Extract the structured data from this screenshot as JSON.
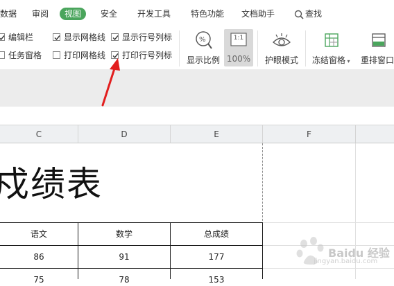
{
  "menu": {
    "tabs": [
      "数据",
      "审阅",
      "视图",
      "安全",
      "开发工具",
      "特色功能",
      "文档助手"
    ],
    "active": "视图",
    "search_label": "查找"
  },
  "ribbon": {
    "checkboxes": [
      {
        "label": "编辑栏",
        "checked": true
      },
      {
        "label": "任务窗格",
        "checked": false
      },
      {
        "label": "显示网格线",
        "checked": true
      },
      {
        "label": "打印网格线",
        "checked": false
      },
      {
        "label": "显示行号列标",
        "checked": true
      },
      {
        "label": "打印行号列标",
        "checked": true
      }
    ],
    "tools": {
      "zoom_ratio": "显示比例",
      "zoom_100": "100%",
      "zoom_100_icon_text": "1:1",
      "eye_mode": "护眼模式",
      "freeze": "冻结窗格",
      "rearrange": "重排窗口"
    }
  },
  "sheet": {
    "columns": [
      "C",
      "D",
      "E",
      "F"
    ],
    "title_fragment": "戍绩表",
    "table": {
      "headers": [
        "语文",
        "数学",
        "总成绩"
      ],
      "rows": [
        [
          "86",
          "91",
          "177"
        ],
        [
          "75",
          "78",
          "153"
        ]
      ]
    }
  },
  "watermark": {
    "text": "Baidu 经验",
    "sub": "jingyan.baidu.com"
  },
  "colors": {
    "active_tab": "#4aa55c",
    "arrow": "#e21e1e",
    "header_bg": "#eef0f2"
  }
}
